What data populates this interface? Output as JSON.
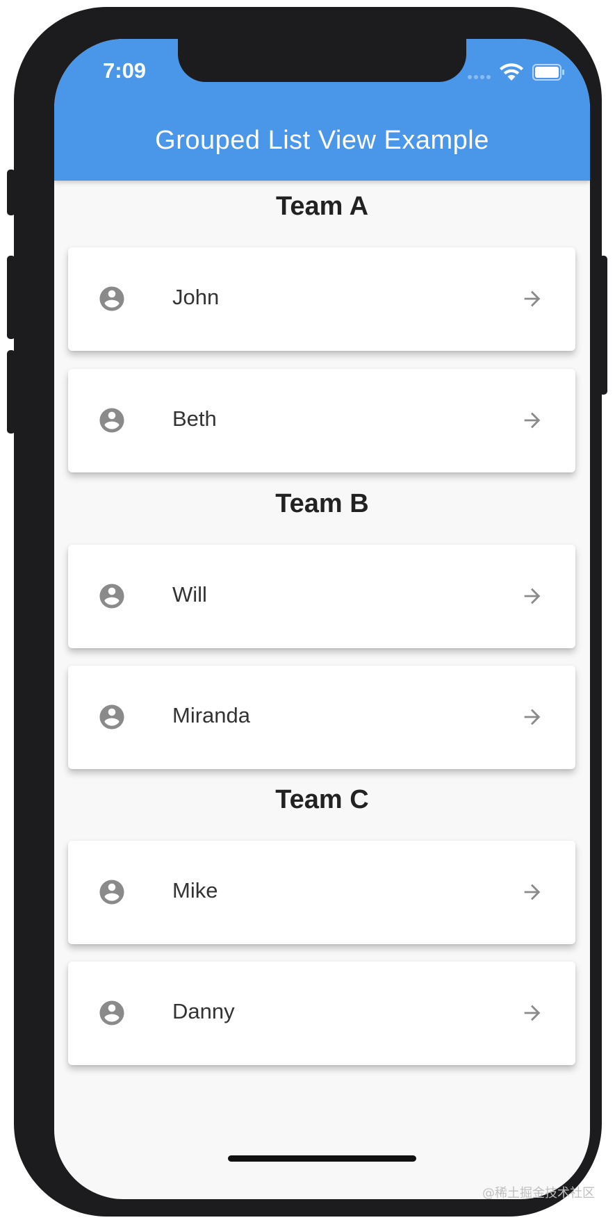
{
  "status_bar": {
    "time": "7:09"
  },
  "app_bar": {
    "title": "Grouped List View Example",
    "color": "#4a97ea"
  },
  "groups": [
    {
      "header": "Team A",
      "items": [
        {
          "name": "John",
          "leading_icon": "account-circle-icon",
          "trailing_icon": "arrow-forward-icon"
        },
        {
          "name": "Beth",
          "leading_icon": "account-circle-icon",
          "trailing_icon": "arrow-forward-icon"
        }
      ]
    },
    {
      "header": "Team B",
      "items": [
        {
          "name": "Will",
          "leading_icon": "account-circle-icon",
          "trailing_icon": "arrow-forward-icon"
        },
        {
          "name": "Miranda",
          "leading_icon": "account-circle-icon",
          "trailing_icon": "arrow-forward-icon"
        }
      ]
    },
    {
      "header": "Team C",
      "items": [
        {
          "name": "Mike",
          "leading_icon": "account-circle-icon",
          "trailing_icon": "arrow-forward-icon"
        },
        {
          "name": "Danny",
          "leading_icon": "account-circle-icon",
          "trailing_icon": "arrow-forward-icon"
        }
      ]
    }
  ],
  "watermark": "@稀土掘金技术社区"
}
